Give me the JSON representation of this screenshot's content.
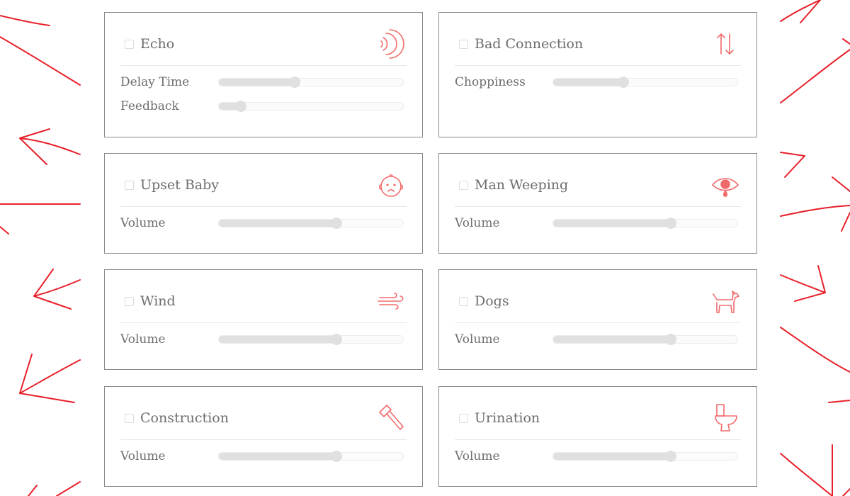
{
  "cards": [
    {
      "title": "Echo",
      "icon": "echo-icon",
      "controls": [
        {
          "label": "Delay Time",
          "value": 0.41
        },
        {
          "label": "Feedback",
          "value": 0.12
        }
      ]
    },
    {
      "title": "Bad Connection",
      "icon": "up-down-arrows-icon",
      "controls": [
        {
          "label": "Choppiness",
          "value": 0.38
        }
      ]
    },
    {
      "title": "Upset Baby",
      "icon": "baby-face-icon",
      "controls": [
        {
          "label": "Volume",
          "value": 0.64
        }
      ]
    },
    {
      "title": "Man Weeping",
      "icon": "weeping-eye-icon",
      "controls": [
        {
          "label": "Volume",
          "value": 0.64
        }
      ]
    },
    {
      "title": "Wind",
      "icon": "wind-icon",
      "controls": [
        {
          "label": "Volume",
          "value": 0.64
        }
      ]
    },
    {
      "title": "Dogs",
      "icon": "dog-icon",
      "controls": [
        {
          "label": "Volume",
          "value": 0.64
        }
      ]
    },
    {
      "title": "Construction",
      "icon": "hammer-icon",
      "controls": [
        {
          "label": "Volume",
          "value": 0.64
        }
      ]
    },
    {
      "title": "Urination",
      "icon": "toilet-icon",
      "controls": [
        {
          "label": "Volume",
          "value": 0.64
        }
      ]
    }
  ],
  "colors": {
    "accent": "#f26b6b",
    "decoration": "#e8202a",
    "border": "#8a8a8a",
    "slider_track": "#e0e0e0"
  }
}
